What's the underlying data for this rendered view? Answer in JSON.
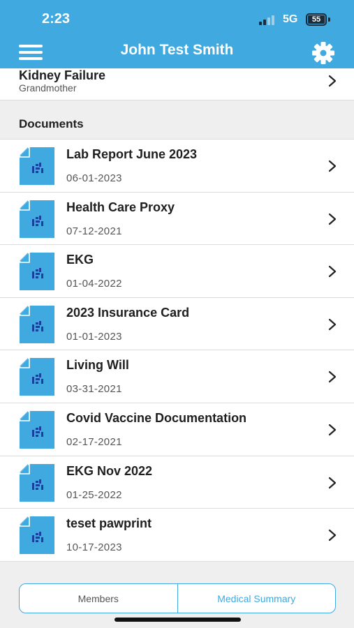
{
  "status_bar": {
    "time": "2:23",
    "network": "5G",
    "battery": "55"
  },
  "header": {
    "title": "John Test Smith"
  },
  "family_history_item": {
    "condition": "Kidney Failure",
    "relation": "Grandmother"
  },
  "documents": {
    "section_label": "Documents",
    "items": [
      {
        "name": "Lab Report June 2023",
        "date": "06-01-2023"
      },
      {
        "name": "Health Care Proxy",
        "date": "07-12-2021"
      },
      {
        "name": "EKG",
        "date": "01-04-2022"
      },
      {
        "name": "2023 Insurance Card",
        "date": "01-01-2023"
      },
      {
        "name": "Living Will",
        "date": "03-31-2021"
      },
      {
        "name": "Covid Vaccine Documentation",
        "date": "02-17-2021"
      },
      {
        "name": "EKG Nov 2022",
        "date": "01-25-2022"
      },
      {
        "name": "teset pawprint",
        "date": "10-17-2023"
      }
    ]
  },
  "tabs": {
    "members": "Members",
    "medical_summary": "Medical Summary"
  },
  "icons": {
    "menu": "hamburger-icon",
    "settings": "gear-icon",
    "document": "document-icon",
    "chevron": "chevron-right-icon"
  },
  "colors": {
    "accent": "#3fa9e0",
    "icon_mark": "#1a3f9e"
  }
}
